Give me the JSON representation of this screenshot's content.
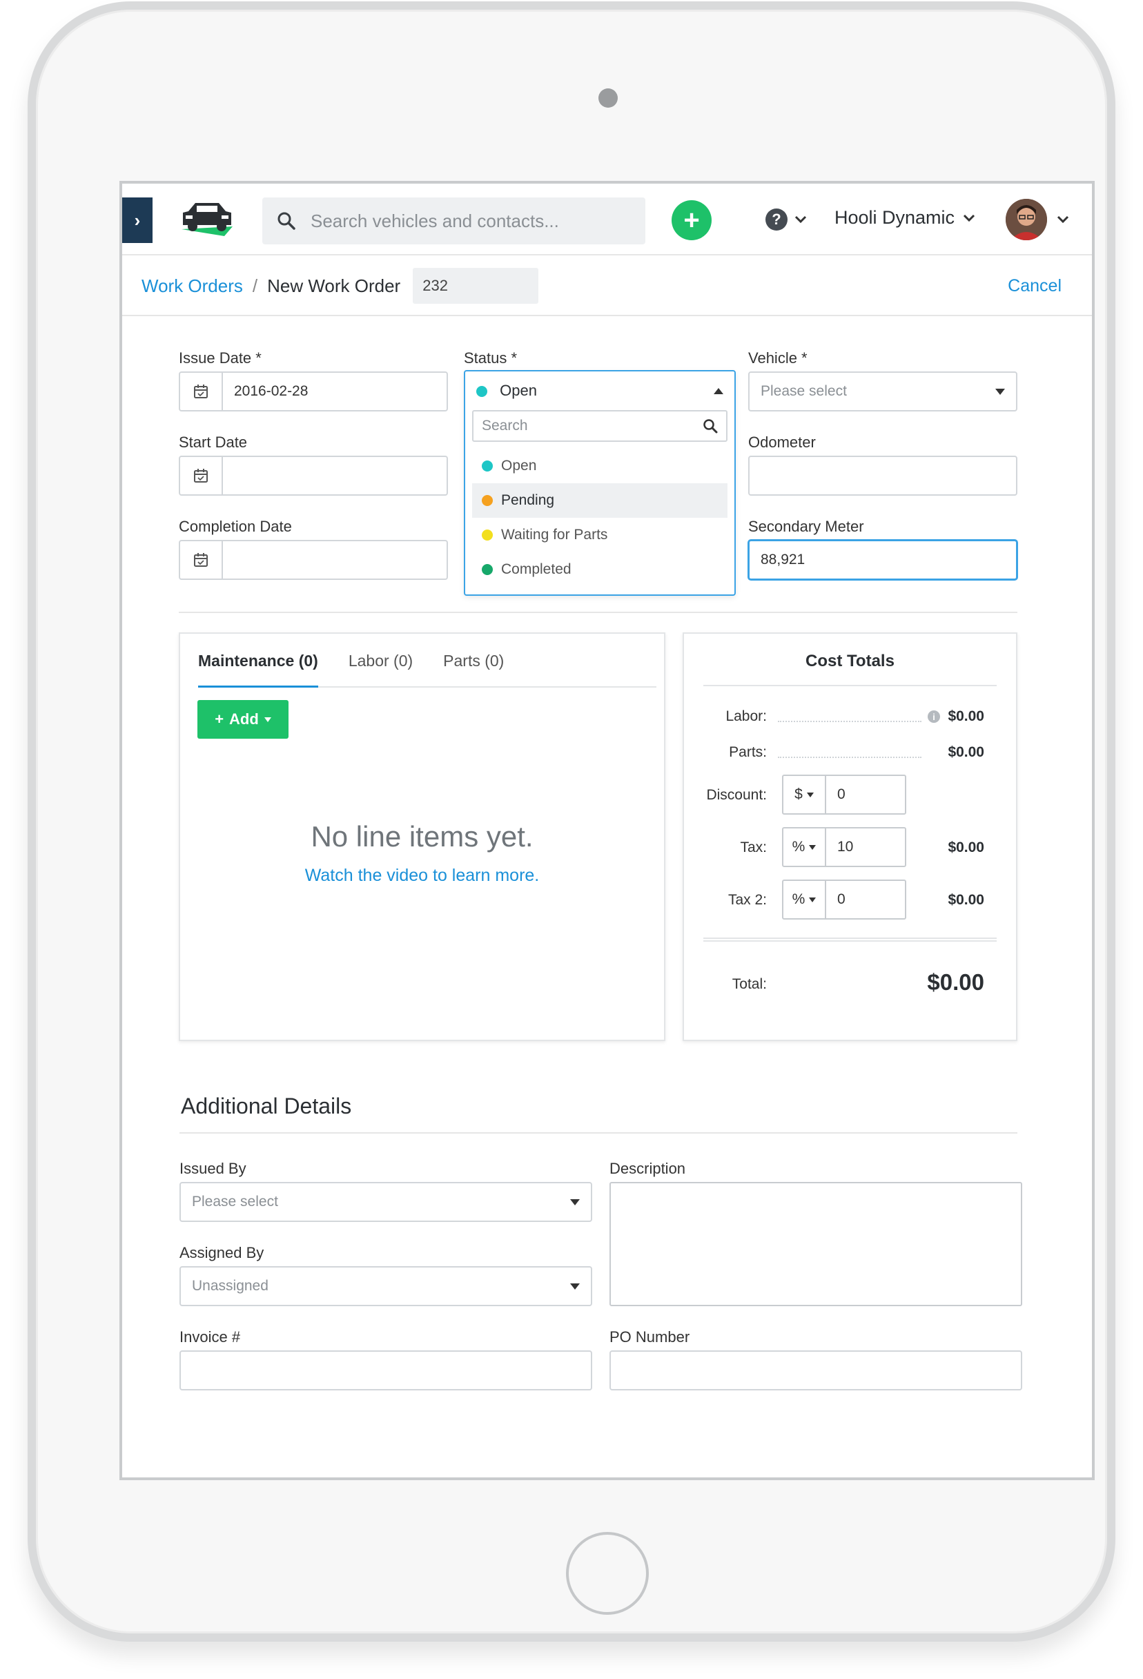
{
  "topbar": {
    "search_placeholder": "Search vehicles and contacts...",
    "account_name": "Hooli Dynamic"
  },
  "breadcrumb": {
    "parent": "Work Orders",
    "separator": "/",
    "current": "New Work Order",
    "number": "232",
    "cancel": "Cancel"
  },
  "form": {
    "issue_date": {
      "label": "Issue Date *",
      "value": "2016-02-28"
    },
    "start_date": {
      "label": "Start Date",
      "value": ""
    },
    "completion_date": {
      "label": "Completion Date",
      "value": ""
    },
    "status": {
      "label": "Status *",
      "selected": "Open",
      "search_placeholder": "Search",
      "options": [
        {
          "label": "Open",
          "color": "#1ec6c6"
        },
        {
          "label": "Pending",
          "color": "#f5a11f"
        },
        {
          "label": "Waiting for Parts",
          "color": "#f2df1e"
        },
        {
          "label": "Completed",
          "color": "#17a86a"
        }
      ],
      "highlighted": "Pending"
    },
    "vehicle": {
      "label": "Vehicle *",
      "placeholder": "Please select"
    },
    "odometer": {
      "label": "Odometer",
      "value": ""
    },
    "secondary_meter": {
      "label": "Secondary Meter",
      "value": "88,921"
    }
  },
  "line_items": {
    "tabs": [
      "Maintenance (0)",
      "Labor (0)",
      "Parts (0)"
    ],
    "active_tab": "Maintenance (0)",
    "add_label": "Add",
    "empty_title": "No line items yet.",
    "empty_link": "Watch the video to learn more."
  },
  "cost_totals": {
    "title": "Cost Totals",
    "labor": {
      "label": "Labor:",
      "amount": "$0.00"
    },
    "parts": {
      "label": "Parts:",
      "amount": "$0.00"
    },
    "discount": {
      "label": "Discount:",
      "unit": "$",
      "value": "0"
    },
    "tax": {
      "label": "Tax:",
      "unit": "%",
      "value": "10",
      "amount": "$0.00"
    },
    "tax2": {
      "label": "Tax 2:",
      "unit": "%",
      "value": "0",
      "amount": "$0.00"
    },
    "total": {
      "label": "Total:",
      "amount": "$0.00"
    }
  },
  "additional": {
    "title": "Additional Details",
    "issued_by": {
      "label": "Issued By",
      "placeholder": "Please select"
    },
    "assigned_by": {
      "label": "Assigned By",
      "placeholder": "Unassigned"
    },
    "invoice": {
      "label": "Invoice #",
      "value": ""
    },
    "description": {
      "label": "Description",
      "value": ""
    },
    "po_number": {
      "label": "PO Number",
      "value": ""
    }
  },
  "colors": {
    "brand_green": "#1ec169",
    "link_blue": "#1a90d8",
    "sidebar_navy": "#1d3a55",
    "focus_blue": "#3ba3e5"
  }
}
